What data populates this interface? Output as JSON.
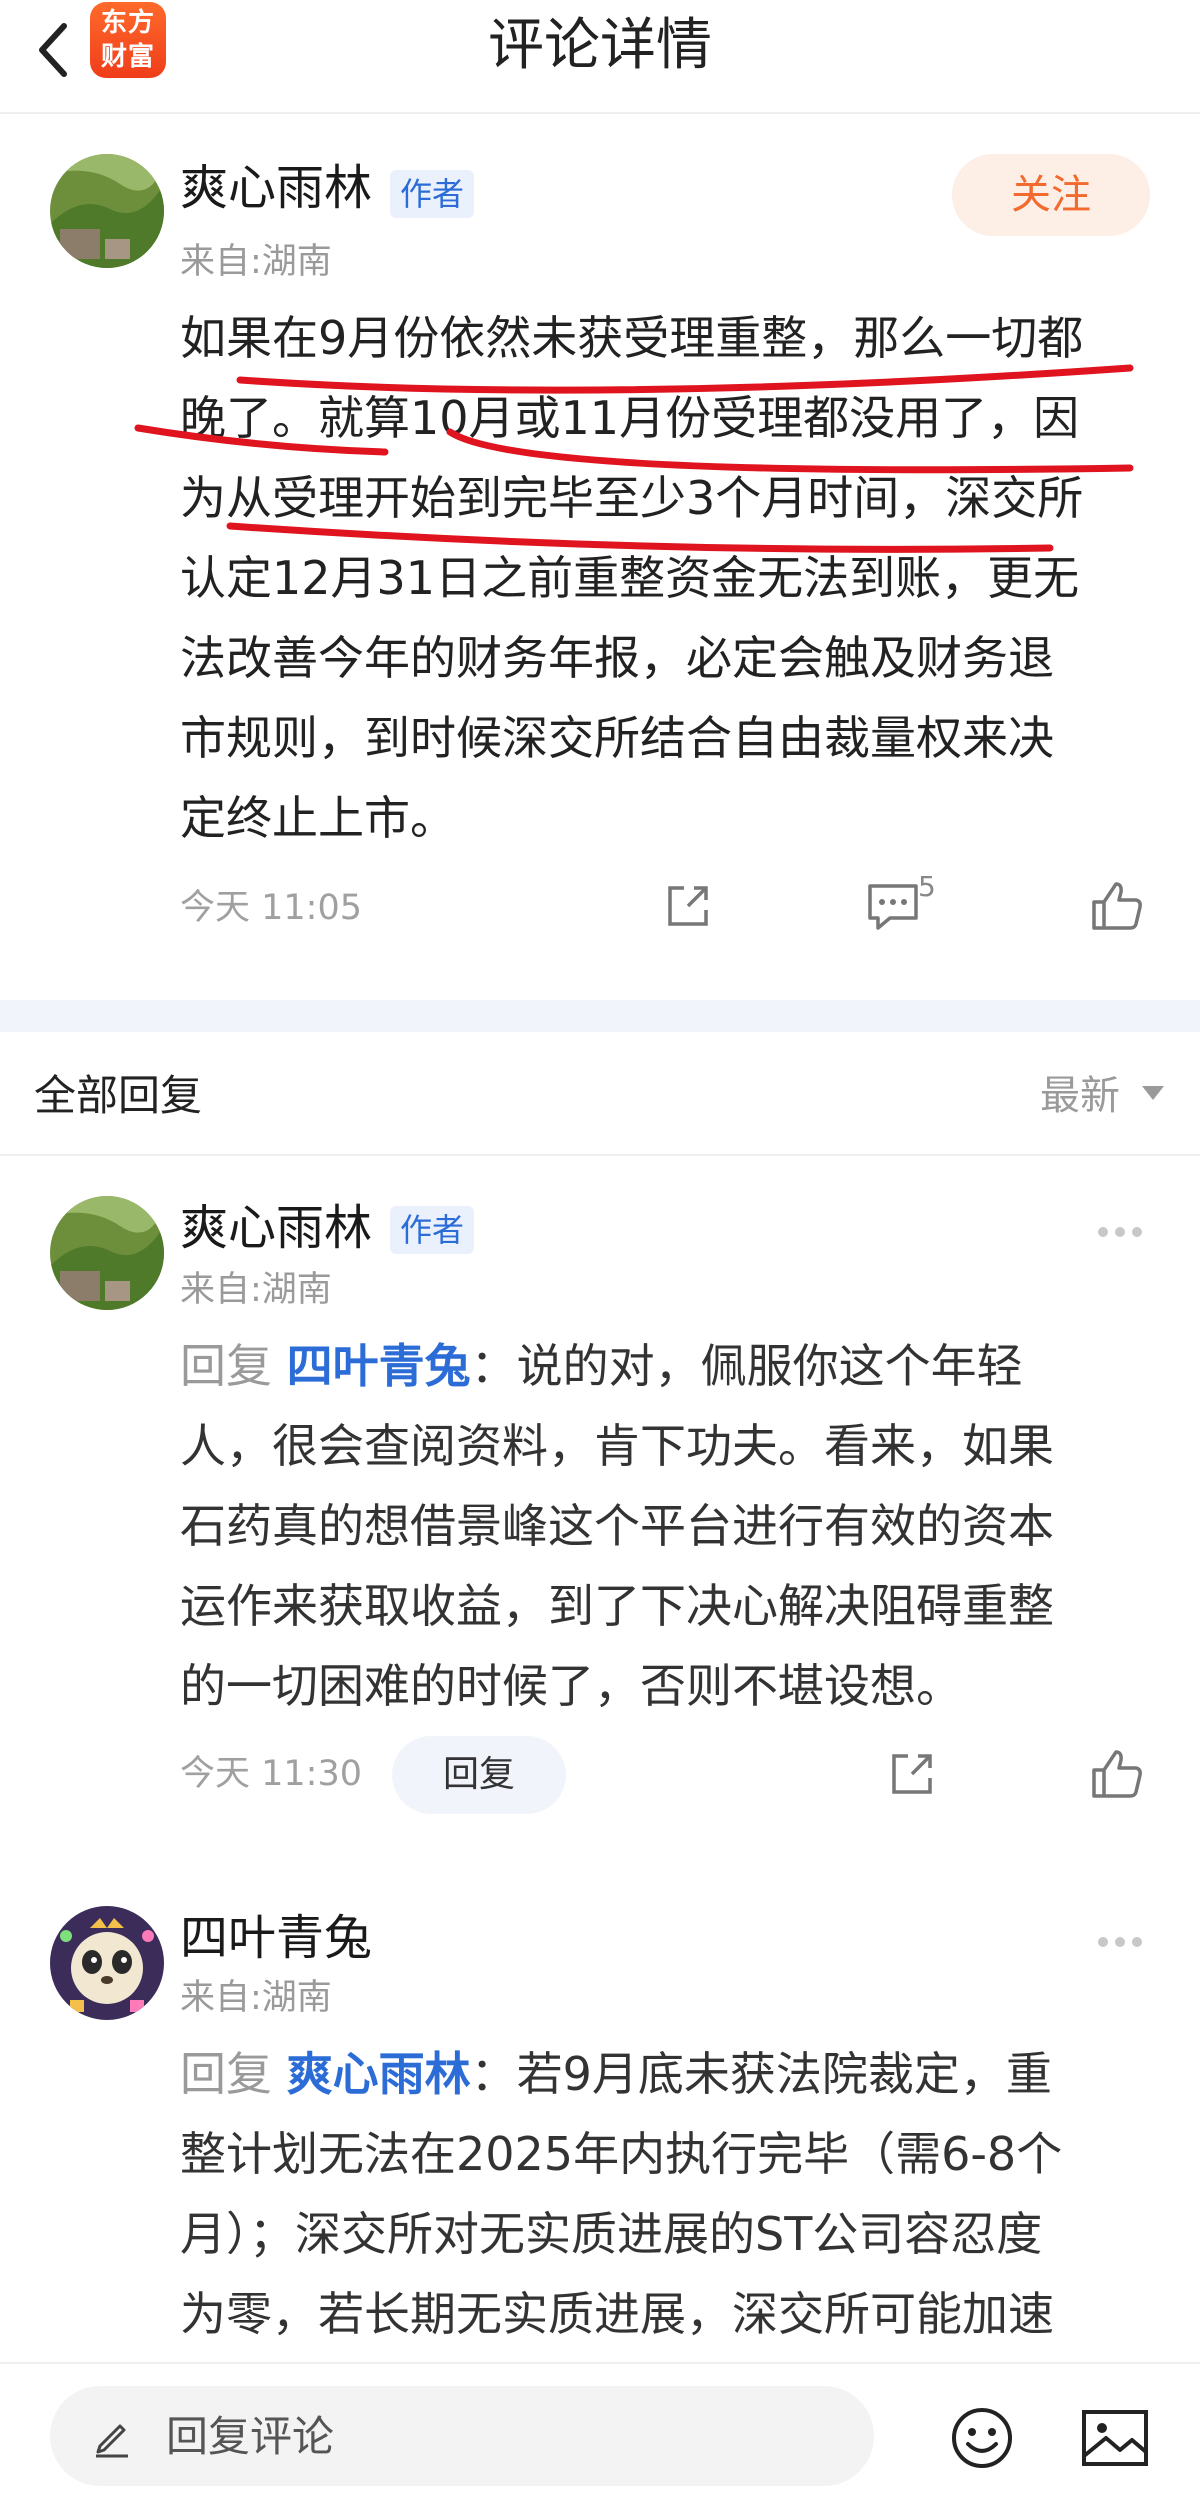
{
  "header": {
    "title": "评论详情",
    "logo_text_line1": "东方",
    "logo_text_line2": "财富"
  },
  "main_comment": {
    "user_name": "爽心雨林",
    "author_tag": "作者",
    "location": "来自:湖南",
    "follow_label": "关注",
    "text_lines": [
      "如果在9月份依然未获受理重整，那么一切都",
      "晚了。就算10月或11月份受理都没用了，因",
      "为从受理开始到完毕至少3个月时间，深交所",
      "认定12月31日之前重整资金无法到账，更无",
      "法改善今年的财务年报，必定会触及财务退",
      "市规则，到时候深交所结合自由裁量权来决",
      "定终止上市。"
    ],
    "time": "今天 11:05",
    "comment_count": "5",
    "underline_color": "#e0141e"
  },
  "replies_section": {
    "title": "全部回复",
    "sort_label": "最新"
  },
  "replies": [
    {
      "user_name": "爽心雨林",
      "author_tag": "作者",
      "location": "来自:湖南",
      "reply_prefix": "回复",
      "reply_target": "四叶青兔",
      "colon": "：",
      "text_lines": [
        "说的对，佩服你这个年轻",
        "人，很会查阅资料，肯下功夫。看来，如果",
        "石药真的想借景峰这个平台进行有效的资本",
        "运作来获取收益，到了下决心解决阻碍重整",
        "的一切困难的时候了，否则不堪设想。"
      ],
      "time": "今天 11:30",
      "reply_button": "回复"
    },
    {
      "user_name": "四叶青兔",
      "location": "来自:湖南",
      "reply_prefix": "回复",
      "reply_target": "爽心雨林",
      "colon": "：",
      "text_lines": [
        "若9月底未获法院裁定，重",
        "整计划无法在2025年内执行完毕（需6-8个",
        "月）；深交所对无实质进展的ST公司容忍度",
        "为零，若长期无实质进展，深交所可能加速"
      ]
    }
  ],
  "bottom_bar": {
    "input_placeholder": "回复评论"
  },
  "colors": {
    "accent_blue": "#2c6cd6",
    "follow_orange": "#f26a2d",
    "logo_red": "#ef3d1a"
  },
  "icons": [
    "back-arrow-icon",
    "app-logo",
    "share-icon",
    "comment-icon",
    "like-icon",
    "more-dots-icon",
    "sort-arrow-icon",
    "pencil-icon",
    "emoji-icon",
    "image-icon"
  ]
}
